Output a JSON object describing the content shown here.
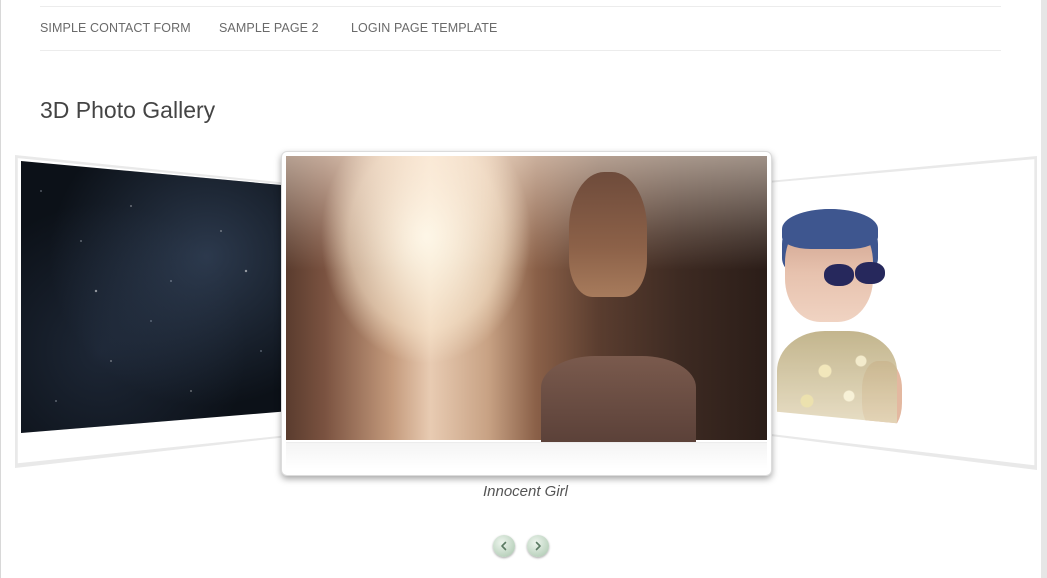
{
  "nav": {
    "items": [
      {
        "label": "SIMPLE CONTACT FORM"
      },
      {
        "label": "SAMPLE PAGE 2"
      },
      {
        "label": "LOGIN PAGE TEMPLATE"
      }
    ]
  },
  "page": {
    "title": "3D Photo Gallery"
  },
  "gallery": {
    "caption": "Innocent Girl",
    "prev_icon": "chevron-left-icon",
    "next_icon": "chevron-right-icon",
    "colors": {
      "button": "#bcd3bf",
      "card_border": "#dcdcdc"
    }
  }
}
